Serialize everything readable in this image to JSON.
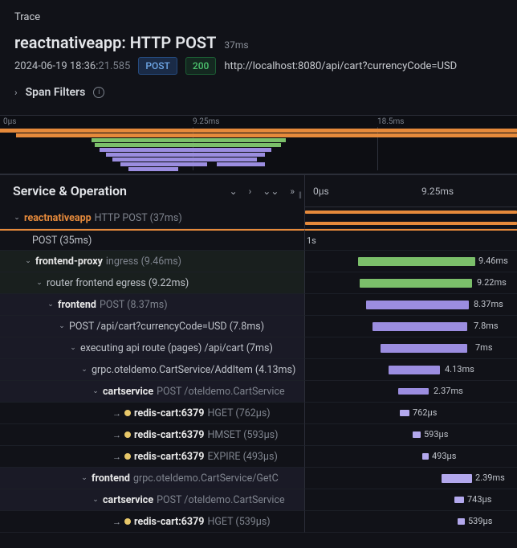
{
  "panel_title": "Trace",
  "title": {
    "text": "reactnativeapp: HTTP POST",
    "duration": "37ms"
  },
  "meta": {
    "timestamp_main": "2024-06-19 18:36:",
    "timestamp_ms": "21.585",
    "method": "POST",
    "status": "200",
    "url": "http://localhost:8080/api/cart?currencyCode=USD"
  },
  "filters": {
    "label": "Span Filters"
  },
  "minimap": {
    "t0": "0μs",
    "t1": "9.25ms",
    "t2": "18.5ms"
  },
  "left_header": "Service & Operation",
  "timeline": {
    "t0": "0μs",
    "t1": "9.25ms"
  },
  "rows": [
    {
      "svc": "reactnativeapp",
      "op": "HTTP POST (37ms)",
      "dur": ""
    },
    {
      "svc": "",
      "op": "POST (35ms)",
      "dur": ""
    },
    {
      "svc": "frontend-proxy",
      "op": "ingress (9.46ms)",
      "dur": "9.46ms"
    },
    {
      "svc": "",
      "op": "router frontend egress (9.22ms)",
      "dur": "9.22ms"
    },
    {
      "svc": "frontend",
      "op": "POST (8.37ms)",
      "dur": "8.37ms"
    },
    {
      "svc": "",
      "op": "POST /api/cart?currencyCode=USD (7.8ms)",
      "dur": "7.8ms"
    },
    {
      "svc": "",
      "op": "executing api route (pages) /api/cart (7ms)",
      "dur": "7ms"
    },
    {
      "svc": "",
      "op": "grpc.oteldemo.CartService/AddItem (4.13ms)",
      "dur": "4.13ms"
    },
    {
      "svc": "cartservice",
      "op": "POST /oteldemo.CartService",
      "dur": "2.37ms"
    },
    {
      "svc": "redis-cart:6379",
      "op": "HGET (762μs)",
      "dur": "762μs"
    },
    {
      "svc": "redis-cart:6379",
      "op": "HMSET (593μs)",
      "dur": "593μs"
    },
    {
      "svc": "redis-cart:6379",
      "op": "EXPIRE (493μs)",
      "dur": "493μs"
    },
    {
      "svc": "frontend",
      "op": "grpc.oteldemo.CartService/GetC",
      "dur": "2.39ms"
    },
    {
      "svc": "cartservice",
      "op": "POST /oteldemo.CartService",
      "dur": "743μs"
    },
    {
      "svc": "redis-cart:6379",
      "op": "HGET (539μs)",
      "dur": "539μs"
    }
  ]
}
